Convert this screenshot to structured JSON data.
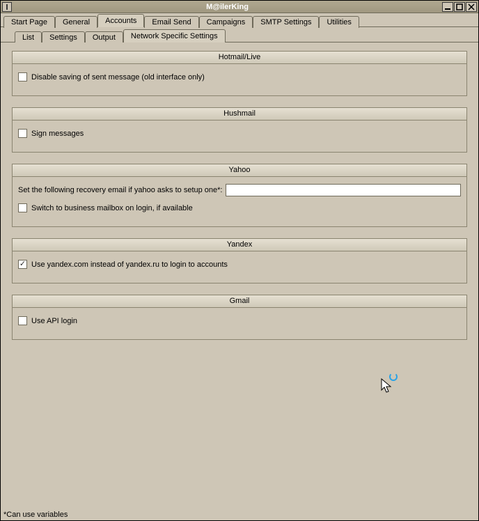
{
  "window": {
    "title": "M@ilerKing"
  },
  "main_tabs": {
    "items": [
      {
        "label": "Start Page"
      },
      {
        "label": "General"
      },
      {
        "label": "Accounts"
      },
      {
        "label": "Email Send"
      },
      {
        "label": "Campaigns"
      },
      {
        "label": "SMTP Settings"
      },
      {
        "label": "Utilities"
      }
    ],
    "active_index": 2
  },
  "sub_tabs": {
    "items": [
      {
        "label": "List"
      },
      {
        "label": "Settings"
      },
      {
        "label": "Output"
      },
      {
        "label": "Network Specific Settings"
      }
    ],
    "active_index": 3
  },
  "groups": {
    "hotmail": {
      "title": "Hotmail/Live",
      "disable_saving": {
        "label": "Disable saving of sent message (old interface only)",
        "checked": false
      }
    },
    "hushmail": {
      "title": "Hushmail",
      "sign_messages": {
        "label": "Sign messages",
        "checked": false
      }
    },
    "yahoo": {
      "title": "Yahoo",
      "recovery_label": "Set the following recovery email if yahoo asks to setup one*:",
      "recovery_value": "",
      "switch_business": {
        "label": "Switch to business mailbox on login, if available",
        "checked": false
      }
    },
    "yandex": {
      "title": "Yandex",
      "use_com": {
        "label": "Use yandex.com instead of yandex.ru to login to accounts",
        "checked": true
      }
    },
    "gmail": {
      "title": "Gmail",
      "use_api": {
        "label": "Use API login",
        "checked": false
      }
    }
  },
  "footer_note": "*Can use variables"
}
